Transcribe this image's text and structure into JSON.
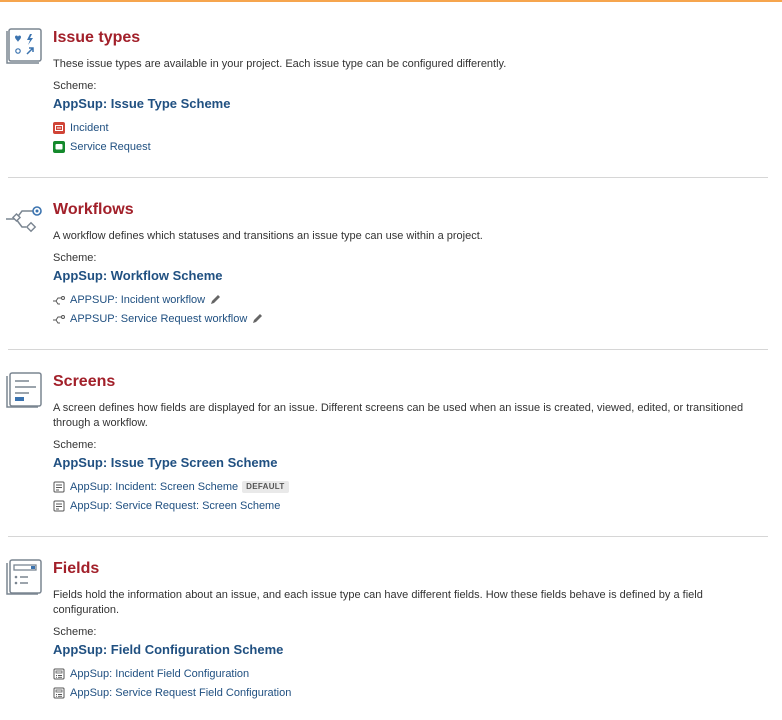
{
  "issue_types": {
    "title": "Issue types",
    "description": "These issue types are available in your project. Each issue type can be configured differently.",
    "scheme_label": "Scheme:",
    "scheme_name": "AppSup: Issue Type Scheme",
    "items": [
      {
        "label": "Incident",
        "icon": "incident-icon",
        "color": "#d04437"
      },
      {
        "label": "Service Request",
        "icon": "service-request-icon",
        "color": "#14892c"
      }
    ]
  },
  "workflows": {
    "title": "Workflows",
    "description": "A workflow defines which statuses and transitions an issue type can use within a project.",
    "scheme_label": "Scheme:",
    "scheme_name": "AppSup: Workflow Scheme",
    "items": [
      {
        "label": "APPSUP: Incident workflow"
      },
      {
        "label": "APPSUP: Service Request workflow"
      }
    ]
  },
  "screens": {
    "title": "Screens",
    "description": "A screen defines how fields are displayed for an issue. Different screens can be used when an issue is created, viewed, edited, or transitioned through a workflow.",
    "scheme_label": "Scheme:",
    "scheme_name": "AppSup: Issue Type Screen Scheme",
    "items": [
      {
        "label": "AppSup: Incident: Screen Scheme",
        "badge": "DEFAULT"
      },
      {
        "label": "AppSup: Service Request: Screen Scheme"
      }
    ]
  },
  "fields": {
    "title": "Fields",
    "description": "Fields hold the information about an issue, and each issue type can have different fields. How these fields behave is defined by a field configuration.",
    "scheme_label": "Scheme:",
    "scheme_name": "AppSup: Field Configuration Scheme",
    "items": [
      {
        "label": "AppSup: Incident Field Configuration"
      },
      {
        "label": "AppSup: Service Request Field Configuration"
      }
    ]
  },
  "colors": {
    "accent_bar": "#f6a54e",
    "title": "#a2202a",
    "link": "#205081"
  }
}
